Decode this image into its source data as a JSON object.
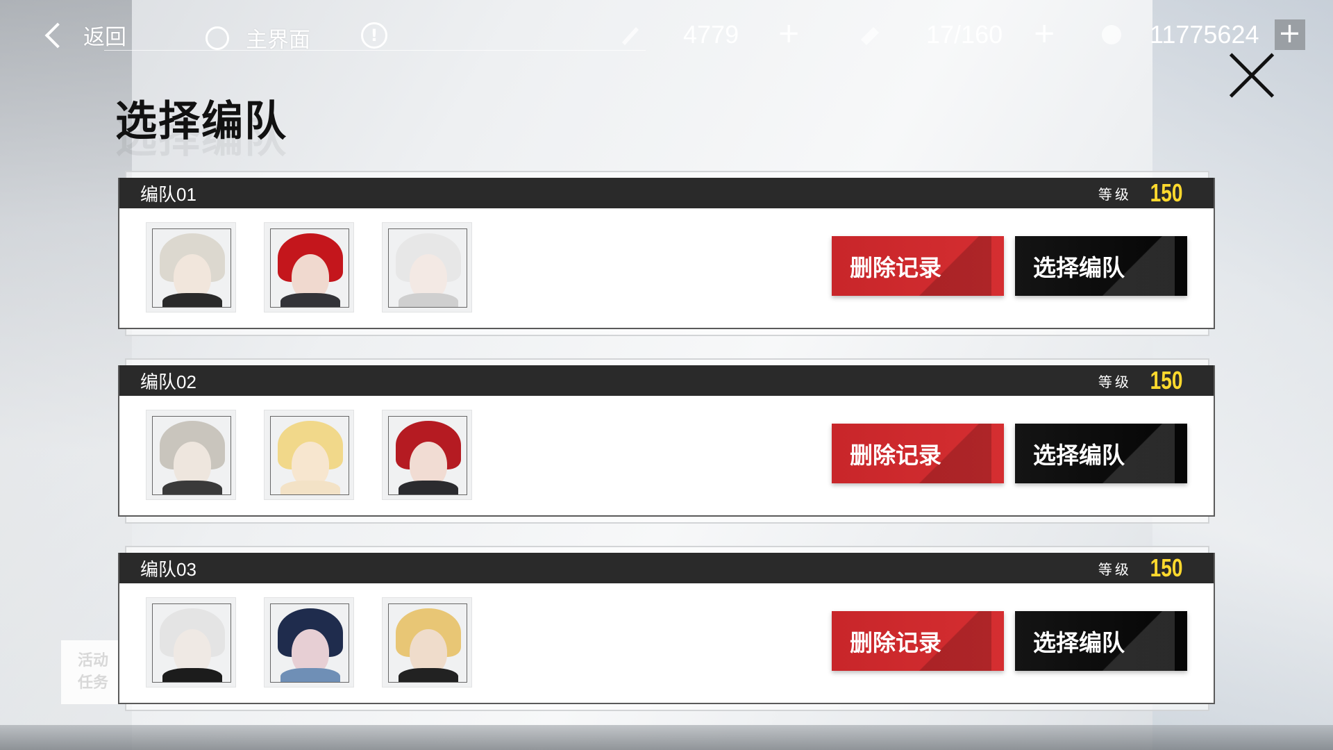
{
  "topbar": {
    "back_label": "返回",
    "home_label": "主界面",
    "info_symbol": "!",
    "resources": [
      {
        "icon": "stamina-icon",
        "value": "4779",
        "plus": "+"
      },
      {
        "icon": "ticket-icon",
        "value": "17/160",
        "plus": "+"
      },
      {
        "icon": "coin-icon",
        "value": "11775624",
        "plus": "+"
      }
    ]
  },
  "title": "选择编队",
  "side_task_label": "活动\n任务",
  "teams": [
    {
      "name": "编队01",
      "level_label": "等级",
      "level": "150",
      "delete_label": "删除记录",
      "select_label": "选择编队",
      "members": [
        {
          "hair": "#dcd8cf",
          "face": "#f1e6dc",
          "body": "#2a2a2a"
        },
        {
          "hair": "#c4161c",
          "face": "#f0d9cf",
          "body": "#333338"
        },
        {
          "hair": "#e7e7e7",
          "face": "#f3e9e4",
          "body": "#cfcfcf"
        }
      ]
    },
    {
      "name": "编队02",
      "level_label": "等级",
      "level": "150",
      "delete_label": "删除记录",
      "select_label": "选择编队",
      "members": [
        {
          "hair": "#c9c5bd",
          "face": "#eee6de",
          "body": "#3a3a3a"
        },
        {
          "hair": "#f1d88a",
          "face": "#f7e6cf",
          "body": "#f3e2c6"
        },
        {
          "hair": "#b51b22",
          "face": "#f1dcd3",
          "body": "#2b2b2f"
        }
      ]
    },
    {
      "name": "编队03",
      "level_label": "等级",
      "level": "150",
      "delete_label": "删除记录",
      "select_label": "选择编队",
      "members": [
        {
          "hair": "#e4e4e4",
          "face": "#efe9e4",
          "body": "#1c1c1c"
        },
        {
          "hair": "#1f2c4d",
          "face": "#e7cfd4",
          "body": "#6f8fb6"
        },
        {
          "hair": "#e8c675",
          "face": "#efdccb",
          "body": "#222222"
        }
      ]
    }
  ]
}
